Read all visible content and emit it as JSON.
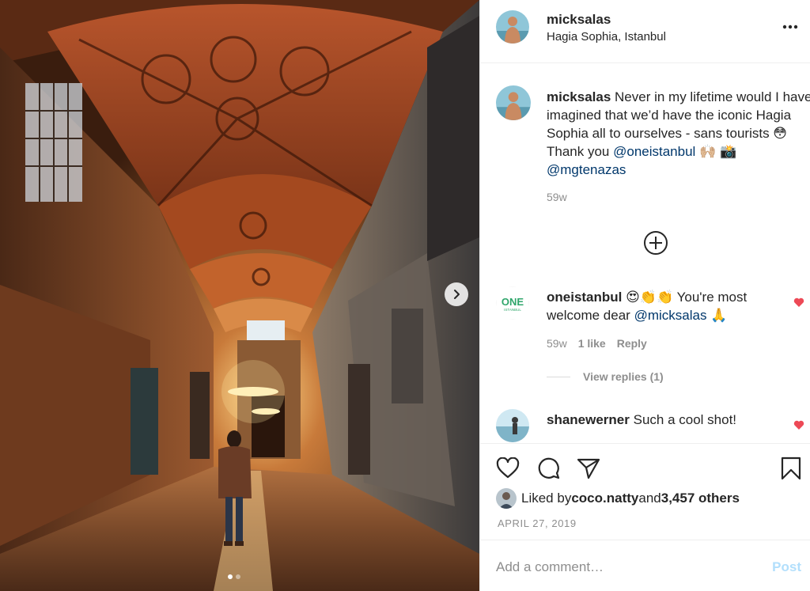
{
  "photo": {
    "description_icon": "hagia-sophia-photo",
    "next_icon": "chevron-right-icon",
    "carousel": {
      "count": 2,
      "active": 1
    }
  },
  "header": {
    "username": "micksalas",
    "location": "Hagia Sophia, Istanbul",
    "more_icon": "more-horizontal-icon"
  },
  "caption": {
    "username": "micksalas",
    "text_1": " Never in my lifetime would I have imagined that we’d have the iconic Hagia Sophia all to ourselves - sans tourists 😳 Thank you ",
    "mention_1": "@oneistanbul",
    "emoji_1": " 🙌🏼 📸 ",
    "mention_2": "@mgtenazas",
    "time": "59w"
  },
  "load_more_icon": "plus-circle-icon",
  "comments": [
    {
      "username": "oneistanbul",
      "avatar_text": "ONE",
      "avatar_subtext": "ISTANBUL",
      "text_1": " 😍👏👏 You're most welcome dear ",
      "mention": "@micksalas",
      "text_2": " 🙏",
      "time": "59w",
      "likes": "1 like",
      "reply": "Reply",
      "view_replies": "View replies (1)"
    },
    {
      "username": "shanewerner",
      "text_1": " Such a cool shot!"
    }
  ],
  "actions": {
    "like_icon": "heart-outline-icon",
    "comment_icon": "comment-bubble-icon",
    "share_icon": "paper-plane-icon",
    "save_icon": "bookmark-icon"
  },
  "likes": {
    "prefix": "Liked by ",
    "user": "coco.natty",
    "middle": " and ",
    "count": "3,457 others"
  },
  "date": "APRIL 27, 2019",
  "add_comment": {
    "placeholder": "Add a comment…",
    "post_label": "Post"
  },
  "colors": {
    "heart_red": "#ed4956",
    "post_disabled": "#b2dffc",
    "mention": "#00376b",
    "secondary_text": "#8e8e8e"
  }
}
